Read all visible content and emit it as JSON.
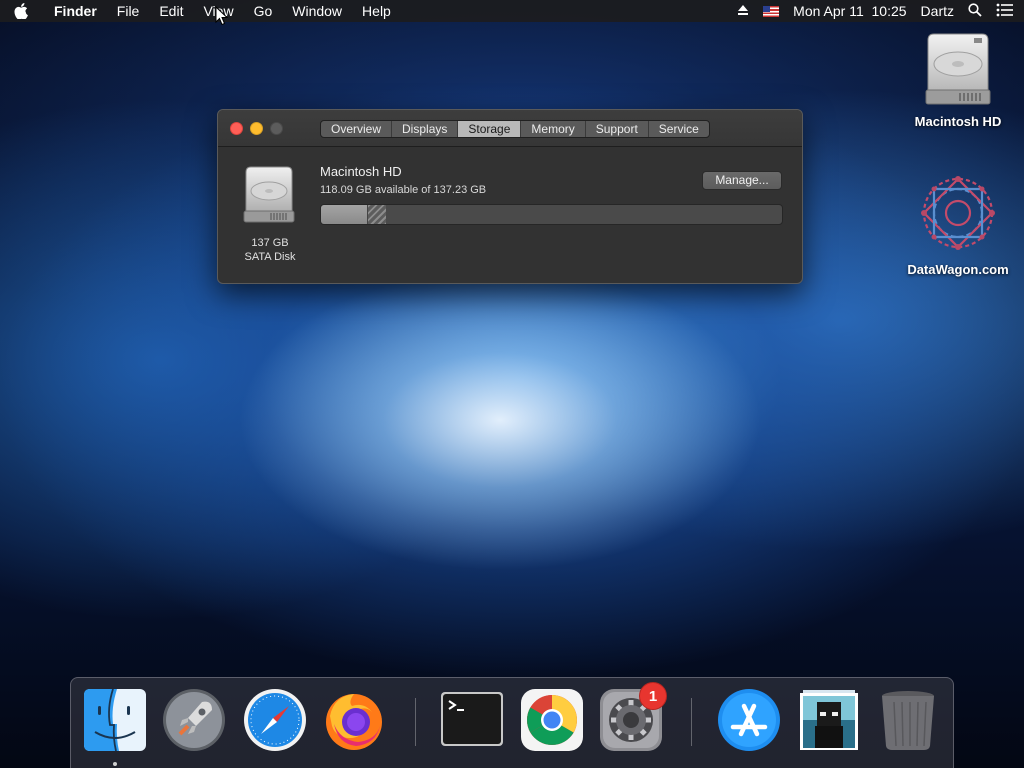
{
  "menubar": {
    "app_name": "Finder",
    "items": [
      "File",
      "Edit",
      "View",
      "Go",
      "Window",
      "Help"
    ],
    "datetime": "Mon Apr 11  10:25",
    "user": "Dartz"
  },
  "window": {
    "tabs": [
      "Overview",
      "Displays",
      "Storage",
      "Memory",
      "Support",
      "Service"
    ],
    "active_tab": "Storage",
    "disk": {
      "size": "137 GB",
      "type": "SATA Disk"
    },
    "volume": {
      "name": "Macintosh HD",
      "available": "118.09 GB available of 137.23 GB",
      "used_fraction": 0.1,
      "other_fraction": 0.04
    },
    "manage_label": "Manage..."
  },
  "desktop": {
    "icons": [
      {
        "label": "Macintosh HD",
        "icon": "hard-drive-icon"
      },
      {
        "label": "DataWagon.com",
        "icon": "datawagon-logo-icon"
      }
    ]
  },
  "dock": {
    "items": [
      {
        "name": "Finder",
        "icon": "finder-icon",
        "running": true
      },
      {
        "name": "Launchpad",
        "icon": "launchpad-icon"
      },
      {
        "name": "Safari",
        "icon": "safari-icon"
      },
      {
        "name": "Firefox",
        "icon": "firefox-icon"
      },
      {
        "name": "Terminal",
        "icon": "terminal-icon"
      },
      {
        "name": "Google Chrome",
        "icon": "chrome-icon"
      },
      {
        "name": "System Preferences",
        "icon": "gear-icon",
        "badge": "1"
      },
      {
        "name": "App Store",
        "icon": "app-store-icon"
      },
      {
        "name": "Downloads",
        "icon": "downloads-stack-icon"
      },
      {
        "name": "Trash",
        "icon": "trash-icon"
      }
    ]
  },
  "colors": {
    "close": "#ff5f57",
    "minimize": "#febc2e",
    "badge": "#e8352f"
  }
}
